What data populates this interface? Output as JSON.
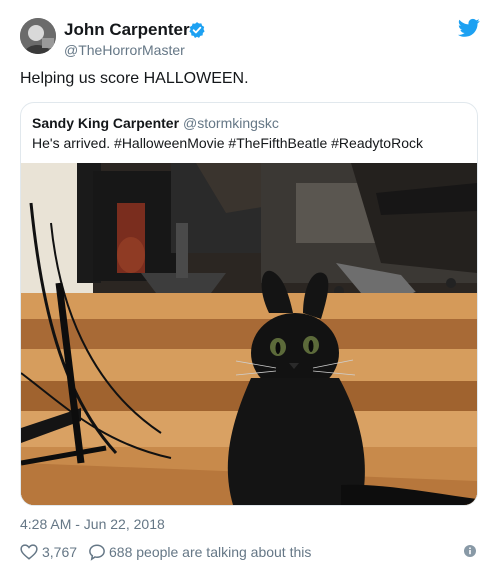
{
  "author": {
    "name": "John Carpenter",
    "handle": "@TheHorrorMaster"
  },
  "tweet": {
    "text": "Helping us score HALLOWEEN."
  },
  "quoted_tweet": {
    "name": "Sandy King Carpenter",
    "handle": "@stormkingskc",
    "text": "He's arrived. #HalloweenMovie #TheFifthBeatle #ReadytoRock"
  },
  "meta": {
    "timestamp": "4:28 AM - Jun 22, 2018"
  },
  "actions": {
    "likes": "3,767",
    "talking": "688 people are talking about this"
  },
  "icons": {
    "verified": "verified-badge-icon",
    "brand": "twitter-bird-icon",
    "like": "heart-icon",
    "reply": "speech-bubble-icon",
    "info": "info-icon"
  },
  "colors": {
    "brand": "#1da1f2",
    "text": "#14171a",
    "secondary": "#657786",
    "border": "#e1e8ed"
  }
}
